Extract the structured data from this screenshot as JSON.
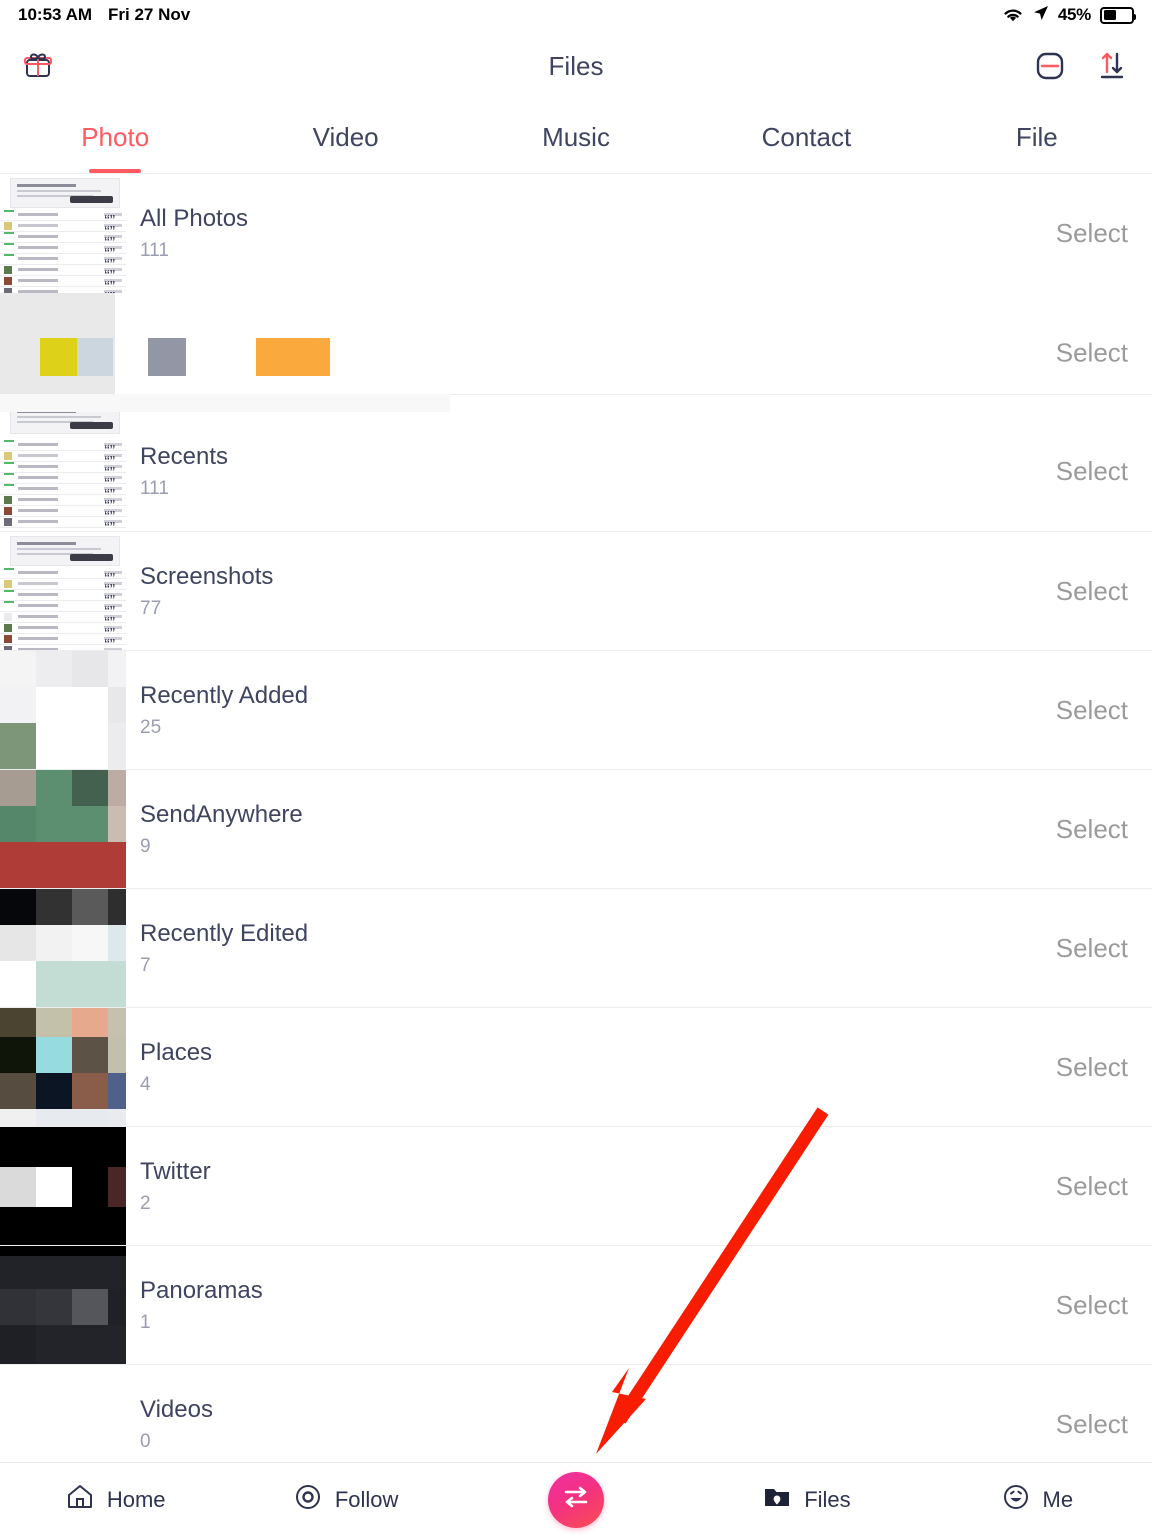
{
  "status_bar": {
    "time": "10:53 AM",
    "date": "Fri 27 Nov",
    "battery_percent": "45%",
    "icons": [
      "wifi-icon",
      "location-arrow-icon",
      "battery-icon"
    ]
  },
  "header": {
    "title": "Files",
    "left_icon": "gift-icon",
    "right_icons": [
      "device-link-icon",
      "transfer-updown-icon"
    ]
  },
  "tabs": [
    {
      "label": "Photo",
      "active": true
    },
    {
      "label": "Video",
      "active": false
    },
    {
      "label": "Music",
      "active": false
    },
    {
      "label": "Contact",
      "active": false
    },
    {
      "label": "File",
      "active": false
    }
  ],
  "list": {
    "select_label": "Select",
    "rows": [
      {
        "title": "All Photos",
        "count": "111"
      },
      {
        "title": "Recents",
        "count": "111"
      },
      {
        "title": "Screenshots",
        "count": "77"
      },
      {
        "title": "Recently Added",
        "count": "25"
      },
      {
        "title": "SendAnywhere",
        "count": "9"
      },
      {
        "title": "Recently Edited",
        "count": "7"
      },
      {
        "title": "Places",
        "count": "4"
      },
      {
        "title": "Twitter",
        "count": "2"
      },
      {
        "title": "Panoramas",
        "count": "1"
      },
      {
        "title": "Videos",
        "count": "0"
      }
    ]
  },
  "bottom_nav": {
    "items": [
      {
        "label": "Home",
        "icon": "home-icon",
        "active": false
      },
      {
        "label": "Follow",
        "icon": "target-icon",
        "active": false
      },
      {
        "label": "Files",
        "icon": "folder-icon",
        "active": true
      },
      {
        "label": "Me",
        "icon": "smiley-icon",
        "active": false
      }
    ],
    "fab": {
      "icon": "transfer-arrows-icon"
    }
  },
  "annotation": {
    "type": "arrow",
    "color": "#f81c০0"
  },
  "colors": {
    "accent": "#ff5a5f",
    "text": "#3f4460",
    "muted": "#9a9db0",
    "select": "#9b9b9b",
    "fab_start": "#ef2fa3",
    "fab_end": "#fa4f4f",
    "annotation": "#f81c00"
  }
}
